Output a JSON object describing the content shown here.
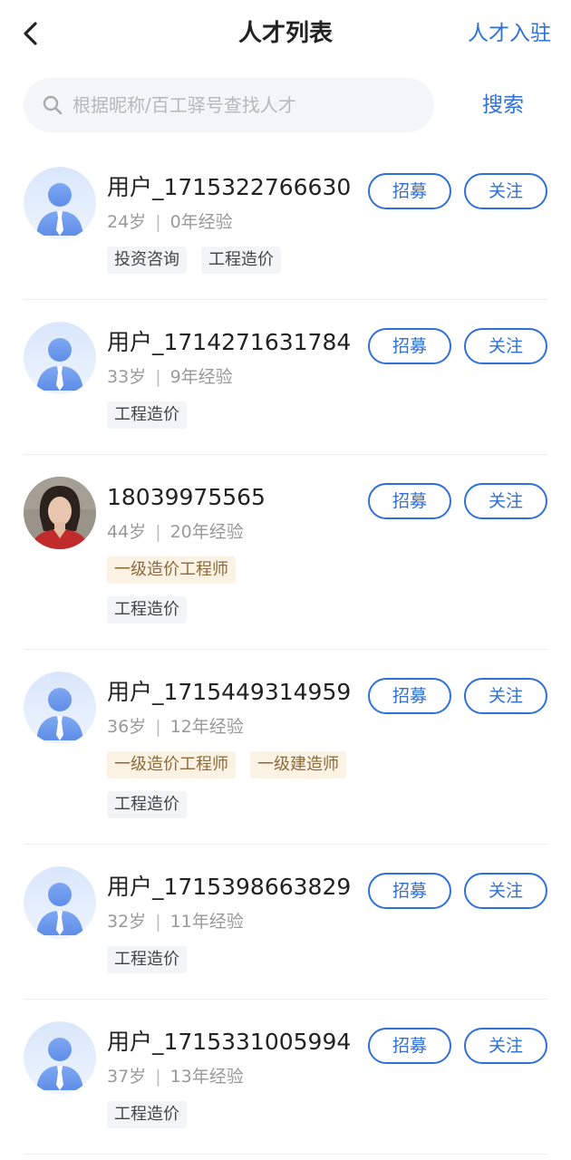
{
  "header": {
    "title": "人才列表",
    "action_label": "人才入驻"
  },
  "search": {
    "placeholder": "根据昵称/百工驿号查找人才",
    "value": "",
    "button_label": "搜索"
  },
  "buttons": {
    "recruit": "招募",
    "follow": "关注"
  },
  "colors": {
    "accent": "#2f6fd8",
    "cert_tag_bg": "#fbf2e3",
    "plain_tag_bg": "#f3f4f6"
  },
  "talents": [
    {
      "name": "用户_1715322766630",
      "age": "24岁",
      "experience": "0年经验",
      "avatar": "default-avatar",
      "cert_tags": [],
      "tags": [
        "投资咨询",
        "工程造价"
      ]
    },
    {
      "name": "用户_1714271631784",
      "age": "33岁",
      "experience": "9年经验",
      "avatar": "default-avatar",
      "cert_tags": [],
      "tags": [
        "工程造价"
      ]
    },
    {
      "name": "18039975565",
      "age": "44岁",
      "experience": "20年经验",
      "avatar": "photo-avatar",
      "cert_tags": [
        "一级造价工程师"
      ],
      "tags": [
        "工程造价"
      ]
    },
    {
      "name": "用户_1715449314959",
      "age": "36岁",
      "experience": "12年经验",
      "avatar": "default-avatar",
      "cert_tags": [
        "一级造价工程师",
        "一级建造师"
      ],
      "tags": [
        "工程造价"
      ]
    },
    {
      "name": "用户_1715398663829",
      "age": "32岁",
      "experience": "11年经验",
      "avatar": "default-avatar",
      "cert_tags": [],
      "tags": [
        "工程造价"
      ]
    },
    {
      "name": "用户_1715331005994",
      "age": "37岁",
      "experience": "13年经验",
      "avatar": "default-avatar",
      "cert_tags": [],
      "tags": [
        "工程造价"
      ]
    }
  ]
}
